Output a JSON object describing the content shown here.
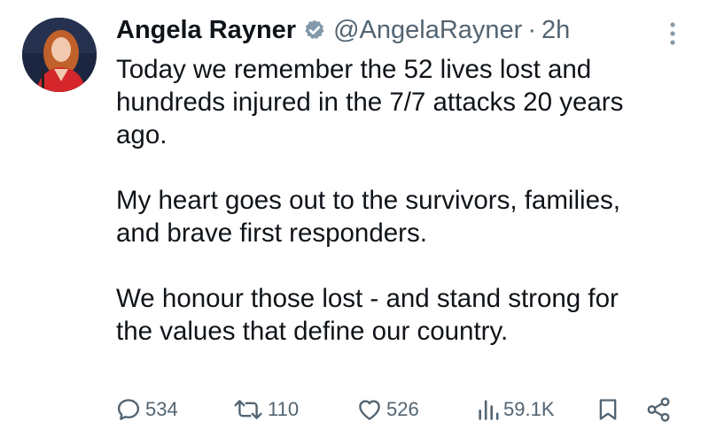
{
  "author": {
    "display_name": "Angela Rayner",
    "handle": "@AngelaRayner",
    "separator": "·",
    "timestamp": "2h",
    "verified_icon": "verified-badge-icon"
  },
  "tweet": {
    "text": "Today we remember the 52 lives lost and\nhundreds injured in the 7/7 attacks 20 years\nago.\n\nMy heart goes out to the survivors, families,\nand brave first responders.\n\nWe honour those lost - and stand strong for\nthe values that define our country."
  },
  "actions": {
    "reply_count": "534",
    "retweet_count": "110",
    "like_count": "526",
    "views_count": "59.1K"
  },
  "colors": {
    "text": "#0f1419",
    "secondary": "#536471",
    "verified": "#829aab"
  }
}
